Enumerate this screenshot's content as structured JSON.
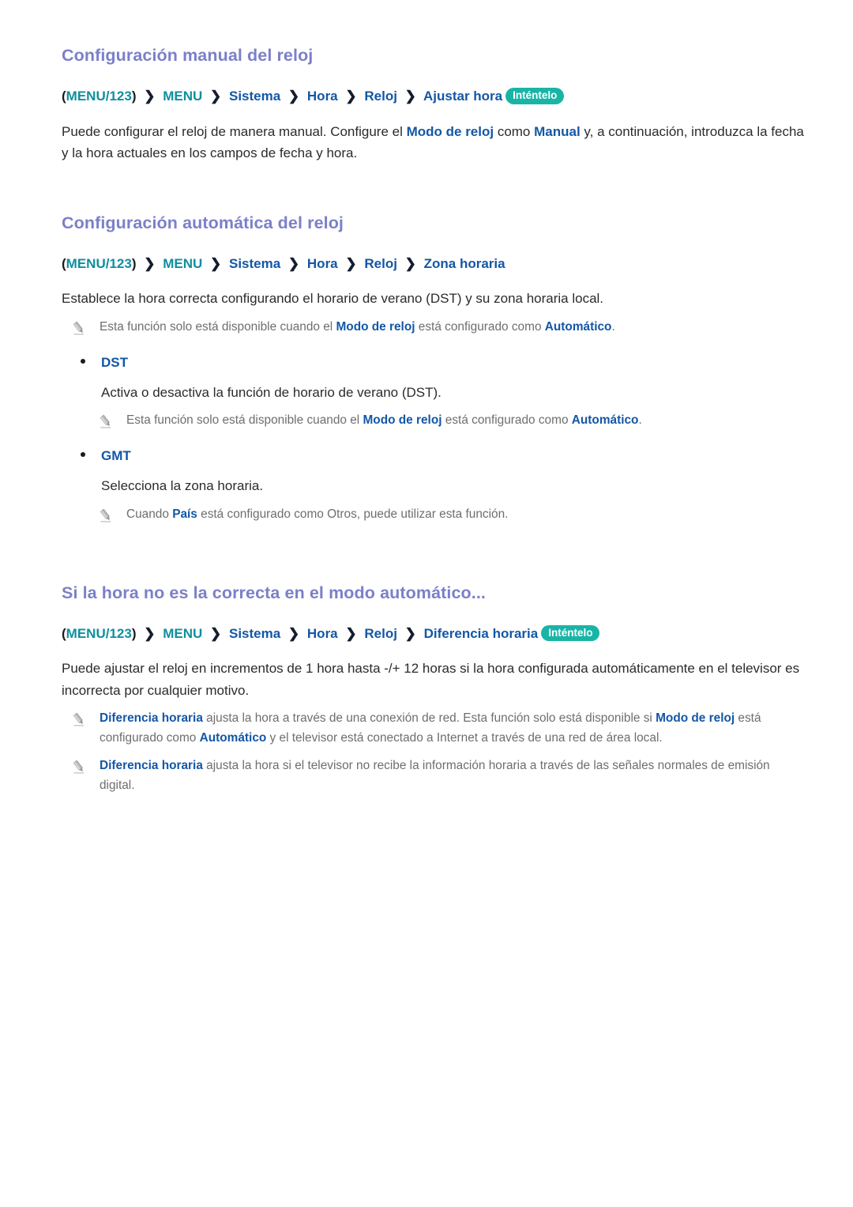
{
  "sections": [
    {
      "title": "Configuración manual del reloj",
      "breadcrumb": {
        "open_paren": "(",
        "menu123": "MENU/123",
        "close_paren": ")",
        "separator": "❯",
        "items": [
          "MENU",
          "Sistema",
          "Hora",
          "Reloj",
          "Ajustar hora"
        ],
        "badge": "Inténtelo"
      },
      "paragraph": {
        "part1": "Puede configurar el reloj de manera manual. Configure el ",
        "kw1": "Modo de reloj",
        "part2": " como ",
        "kw2": "Manual",
        "part3": " y, a continuación, introduzca la fecha y la hora actuales en los campos de fecha y hora."
      }
    },
    {
      "title": "Configuración automática del reloj",
      "breadcrumb": {
        "open_paren": "(",
        "menu123": "MENU/123",
        "close_paren": ")",
        "separator": "❯",
        "items": [
          "MENU",
          "Sistema",
          "Hora",
          "Reloj",
          "Zona horaria"
        ],
        "badge": ""
      },
      "paragraph": {
        "full": "Establece la hora correcta configurando el horario de verano (DST) y su zona horaria local."
      },
      "note_top": {
        "part1": "Esta función solo está disponible cuando el ",
        "kw1": "Modo de reloj",
        "part2": " está configurado como ",
        "kw2": "Automático",
        "part3": "."
      },
      "bullets": [
        {
          "label": "DST",
          "description": "Activa o desactiva la función de horario de verano (DST).",
          "note": {
            "part1": "Esta función solo está disponible cuando el ",
            "kw1": "Modo de reloj",
            "part2": " está configurado como ",
            "kw2": "Automático",
            "part3": "."
          }
        },
        {
          "label": "GMT",
          "description": "Selecciona la zona horaria.",
          "note": {
            "part1": "Cuando ",
            "kw1": "País",
            "part2": " está configurado como Otros, puede utilizar esta función.",
            "kw2": "",
            "part3": ""
          }
        }
      ]
    },
    {
      "title": "Si la hora no es la correcta en el modo automático...",
      "breadcrumb": {
        "open_paren": "(",
        "menu123": "MENU/123",
        "close_paren": ")",
        "separator": "❯",
        "items": [
          "MENU",
          "Sistema",
          "Hora",
          "Reloj",
          "Diferencia horaria"
        ],
        "badge": "Inténtelo"
      },
      "paragraph": {
        "full": "Puede ajustar el reloj en incrementos de 1 hora hasta -/+ 12 horas si la hora configurada automáticamente en el televisor es incorrecta por cualquier motivo."
      },
      "notes": [
        {
          "kw1": "Diferencia horaria",
          "part1": " ajusta la hora a través de una conexión de red. Esta función solo está disponible si ",
          "kw2": "Modo de reloj",
          "part2": " está configurado como ",
          "kw3": "Automático",
          "part3": " y el televisor está conectado a Internet a través de una red de área local."
        },
        {
          "kw1": "Diferencia horaria",
          "part1": " ajusta la hora si el televisor no recibe la información horaria a través de las señales normales de emisión digital.",
          "kw2": "",
          "part2": "",
          "kw3": "",
          "part3": ""
        }
      ]
    }
  ],
  "colors": {
    "heading": "#7b80c8",
    "teal": "#0e8f9e",
    "blue": "#1357a6",
    "badge_bg": "#18b5a7",
    "note_text": "#6e6e6e",
    "body_text": "#2b2b2b"
  }
}
